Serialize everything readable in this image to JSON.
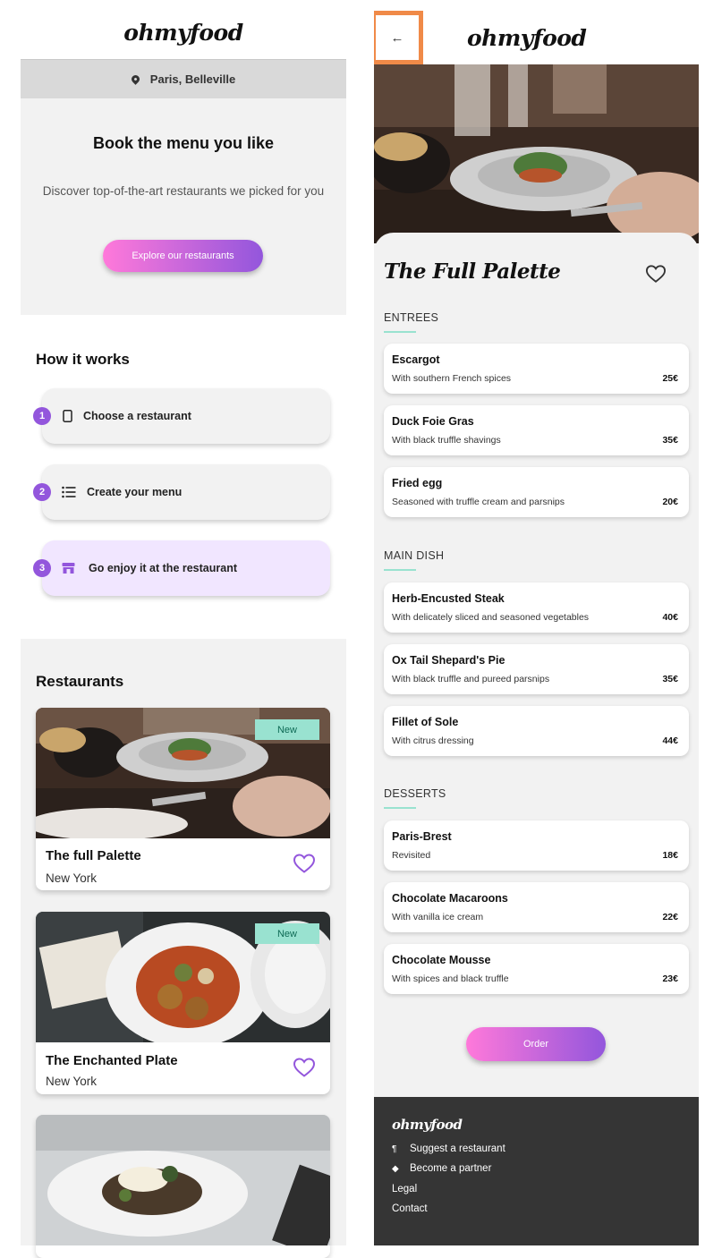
{
  "brand": "ohmyfood",
  "location": "Paris, Belleville",
  "hero": {
    "title": "Book the menu you like",
    "subtitle": "Discover top-of-the-art restaurants we picked for you",
    "cta": "Explore our restaurants"
  },
  "how_it_works": {
    "title": "How it works",
    "steps": [
      {
        "num": "1",
        "label": "Choose a restaurant",
        "icon": "phone-icon"
      },
      {
        "num": "2",
        "label": "Create your menu",
        "icon": "list-icon"
      },
      {
        "num": "3",
        "label": "Go enjoy it at the restaurant",
        "icon": "store-icon"
      }
    ]
  },
  "restaurants": {
    "title": "Restaurants",
    "badge_new": "New",
    "items": [
      {
        "name": "The full Palette",
        "city": "New York",
        "is_new": true
      },
      {
        "name": "The Enchanted Plate",
        "city": "New York",
        "is_new": true
      },
      {
        "name": "",
        "city": "",
        "is_new": false
      }
    ]
  },
  "menu_page": {
    "back_icon": "arrow-left-icon",
    "back_glyph": "←",
    "restaurant_name": "The Full Palette",
    "sections": [
      {
        "title": "ENTREES",
        "dishes": [
          {
            "name": "Escargot",
            "desc": "With southern French spices",
            "price": "25€"
          },
          {
            "name": "Duck Foie Gras",
            "desc": "With black truffle shavings",
            "price": "35€"
          },
          {
            "name": "Fried egg",
            "desc": "Seasoned with truffle cream and parsnips",
            "price": "20€"
          }
        ]
      },
      {
        "title": "MAIN DISH",
        "dishes": [
          {
            "name": "Herb-Encusted Steak",
            "desc": "With delicately sliced and seasoned vegetables",
            "price": "40€"
          },
          {
            "name": "Ox Tail Shepard's Pie",
            "desc": "With black truffle and pureed parsnips",
            "price": "35€"
          },
          {
            "name": "Fillet of Sole",
            "desc": "With citrus dressing",
            "price": "44€"
          }
        ]
      },
      {
        "title": "DESSERTS",
        "dishes": [
          {
            "name": "Paris-Brest",
            "desc": "Revisited",
            "price": "18€"
          },
          {
            "name": "Chocolate Macaroons",
            "desc": "With vanilla ice cream",
            "price": "22€"
          },
          {
            "name": "Chocolate Mousse",
            "desc": "With spices and black truffle",
            "price": "23€"
          }
        ]
      }
    ],
    "order_label": "Order"
  },
  "footer": {
    "logo": "ohmyfood",
    "links": [
      {
        "label": "Suggest a restaurant",
        "icon": "utensils-icon",
        "glyph": "¶"
      },
      {
        "label": "Become a partner",
        "icon": "handshake-icon",
        "glyph": "◆"
      },
      {
        "label": "Legal",
        "icon": "",
        "glyph": ""
      },
      {
        "label": "Contact",
        "icon": "",
        "glyph": ""
      }
    ]
  },
  "colors": {
    "accent_purple": "#9356dc",
    "accent_pink": "#ff79da",
    "badge_teal": "#99e2d0",
    "highlight_orange": "#f08a48",
    "footer_bg": "#353535"
  }
}
